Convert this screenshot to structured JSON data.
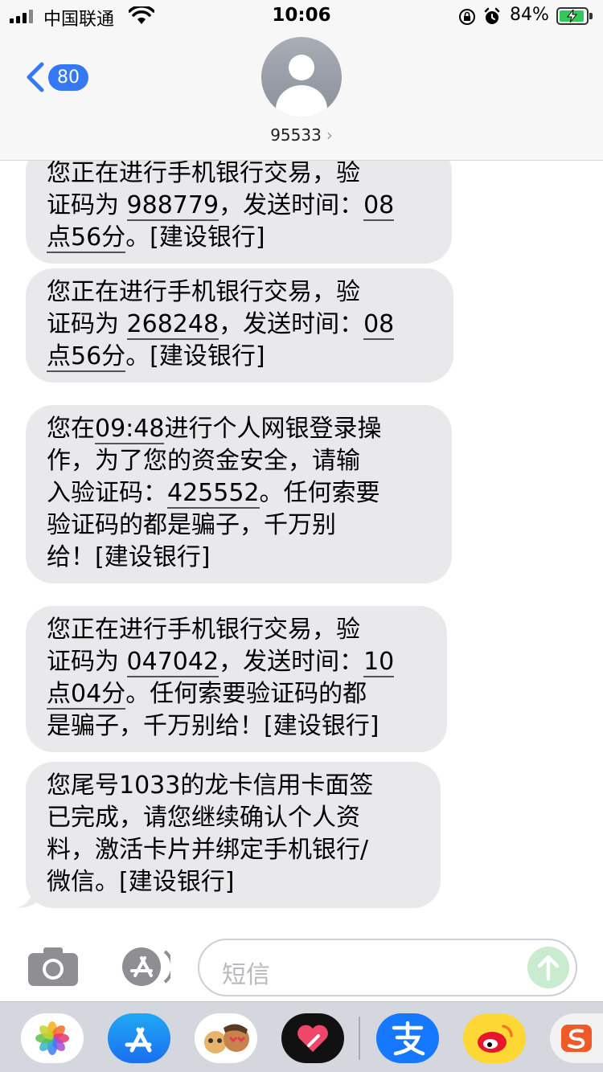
{
  "status_bar": {
    "carrier": "中国联通",
    "time": "10:06",
    "battery_percent": "84%",
    "battery_level": 0.84,
    "icons": [
      "signal-icon",
      "wifi-icon",
      "orientation-lock-icon",
      "alarm-icon",
      "battery-charging-icon"
    ]
  },
  "nav": {
    "back_count": "80",
    "contact": "95533",
    "contact_chevron": "›"
  },
  "messages": [
    {
      "id": "m1",
      "segments": [
        {
          "t": "您正在进行手机银行交易，验\n证码为 "
        },
        {
          "t": "988779",
          "link": true
        },
        {
          "t": "，发送时间："
        },
        {
          "t": "08\n点56分",
          "link": true
        },
        {
          "t": "。[建设银行]"
        }
      ]
    },
    {
      "id": "m2",
      "segments": [
        {
          "t": "您正在进行手机银行交易，验\n证码为 "
        },
        {
          "t": "268248",
          "link": true
        },
        {
          "t": "，发送时间："
        },
        {
          "t": "08\n点56分",
          "link": true
        },
        {
          "t": "。[建设银行]"
        }
      ]
    },
    {
      "id": "m3",
      "segments": [
        {
          "t": "您在"
        },
        {
          "t": "09:48",
          "link": true
        },
        {
          "t": "进行个人网银登录操\n作，为了您的资金安全，请输\n入验证码："
        },
        {
          "t": "425552",
          "link": true
        },
        {
          "t": "。任何索要\n验证码的都是骗子，千万别\n给！[建设银行]"
        }
      ]
    },
    {
      "id": "m4",
      "segments": [
        {
          "t": "您正在进行手机银行交易，验\n证码为 "
        },
        {
          "t": "047042",
          "link": true
        },
        {
          "t": "，发送时间："
        },
        {
          "t": "10\n点04分",
          "link": true
        },
        {
          "t": "。任何索要验证码的都\n是骗子，千万别给！[建设银行]"
        }
      ]
    },
    {
      "id": "m5",
      "segments": [
        {
          "t": "您尾号1033的龙卡信用卡面签\n已完成，请您继续确认个人资\n料，激活卡片并绑定手机银行/\n微信。[建设银行]"
        }
      ]
    }
  ],
  "input_bar": {
    "placeholder": "短信",
    "camera_icon": "camera-icon",
    "apps_icon": "app-store-icon",
    "send_icon": "send-arrow-icon"
  },
  "app_drawer": [
    "photos-app-icon",
    "app-store-app-icon",
    "memoji-app-icon",
    "digital-touch-app-icon",
    "alipay-app-icon",
    "weibo-app-icon",
    "sogou-input-app-icon"
  ]
}
